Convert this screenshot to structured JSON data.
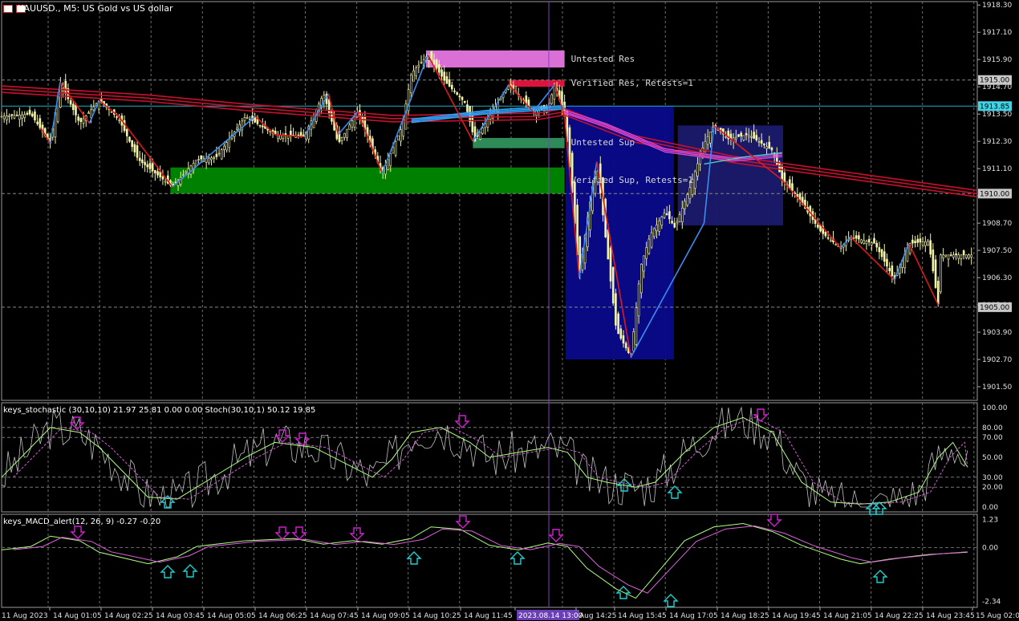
{
  "title": "XAUUSD., M5:  US Gold vs US dollar",
  "colors": {
    "bg": "#000000",
    "grid": "#6e6e6e",
    "bull": "#f5f5a8",
    "bear": "#f5f5a8",
    "ma_red": "#c8102e",
    "ma_magenta": "#d448d4",
    "ma_cyan": "#2ea8ff",
    "zz_blue": "#3b8cf0",
    "zz_red": "#e01919",
    "hline": "#1fb0c6",
    "stoch_main": "#c0c0c0",
    "stoch_sig": "#b0ff80",
    "stoch_dash": "#d060d0",
    "macd_main": "#b0ff80",
    "macd_sig": "#e060e0",
    "arrow_down": "#d020d0",
    "arrow_up": "#20d0d0"
  },
  "zones": [
    {
      "label": "Untested Res",
      "color": "#da70d6",
      "y_top": 1916.3,
      "y_bot": 1915.55,
      "x1": 0.435,
      "x2": 0.577
    },
    {
      "label": "Verified Res, Retests=1",
      "color": "#dc143c",
      "y_top": 1915.0,
      "y_bot": 1914.7,
      "x1": 0.52,
      "x2": 0.577
    },
    {
      "label": "Untested Sup",
      "color": "#2e8b57",
      "y_top": 1912.45,
      "y_bot": 1912.0,
      "x1": 0.483,
      "x2": 0.577
    },
    {
      "label": "Verified Sup, Retests=1",
      "color": "#008000",
      "y_top": 1911.15,
      "y_bot": 1910.0,
      "x1": 0.173,
      "x2": 0.577
    }
  ],
  "boxes": [
    {
      "color": "#0a0a8a",
      "y_top": 1913.85,
      "y_bot": 1902.7,
      "x1": 0.578,
      "x2": 0.689
    },
    {
      "color": "#1a1a6e",
      "y_top": 1913.0,
      "y_bot": 1908.6,
      "x1": 0.693,
      "x2": 0.801
    }
  ],
  "price_axis": {
    "ticks": [
      "1918.30",
      "1917.10",
      "1915.90",
      "1914.70",
      "1913.50",
      "1912.30",
      "1911.10",
      "1909.90",
      "1908.70",
      "1907.50",
      "1906.30",
      "1905.10",
      "1903.90",
      "1902.70",
      "1901.50"
    ],
    "highlight": [
      {
        "value": "1915.00",
        "style": "gray"
      },
      {
        "value": "1913.85",
        "style": "cyan"
      },
      {
        "value": "1910.00",
        "style": "gray"
      },
      {
        "value": "1905.00",
        "style": "gray"
      }
    ]
  },
  "time_axis": [
    "11 Aug 2023",
    "14 Aug 01:05",
    "14 Aug 02:25",
    "14 Aug 03:45",
    "14 Aug 05:05",
    "14 Aug 06:25",
    "14 Aug 07:45",
    "14 Aug 09:05",
    "14 Aug 10:25",
    "14 Aug 11:45",
    "2023.08.14 13:00",
    "Aug 14:25",
    "14 Aug 15:45",
    "14 Aug 17:05",
    "14 Aug 18:25",
    "14 Aug 19:45",
    "14 Aug 21:05",
    "14 Aug 22:25",
    "14 Aug 23:45",
    "15 Aug 02:05"
  ],
  "stoch_panel": {
    "label": "keys_stochastic (30,10,10) 21.97 25.81 0.00 0.00 Stoch(30,10,1) 50.12 19.85",
    "ticks": [
      "100.00",
      "80.00",
      "70.00",
      "50.00",
      "30.00",
      "20.00",
      "0.00"
    ]
  },
  "macd_panel": {
    "label": "keys_MACD_alert(12, 26, 9) -0.27 -0.20",
    "ticks": [
      "1.23",
      "0.00",
      "-2.34"
    ]
  },
  "chart_data": [
    {
      "type": "candlestick",
      "title": "XAUUSD., M5:  US Gold vs US dollar",
      "xlabel": "",
      "ylabel": "",
      "ylim": [
        1900.9,
        1918.45
      ],
      "price_path": [
        [
          0,
          1913.4
        ],
        [
          0.03,
          1913.5
        ],
        [
          0.05,
          1912.2
        ],
        [
          0.06,
          1914.9
        ],
        [
          0.08,
          1913.1
        ],
        [
          0.1,
          1914.1
        ],
        [
          0.12,
          1913.3
        ],
        [
          0.14,
          1911.5
        ],
        [
          0.175,
          1910.3
        ],
        [
          0.2,
          1911.5
        ],
        [
          0.22,
          1911.6
        ],
        [
          0.25,
          1913.4
        ],
        [
          0.28,
          1912.6
        ],
        [
          0.31,
          1912.5
        ],
        [
          0.33,
          1914.4
        ],
        [
          0.345,
          1912.2
        ],
        [
          0.365,
          1913.6
        ],
        [
          0.39,
          1910.9
        ],
        [
          0.41,
          1912.9
        ],
        [
          0.42,
          1915.3
        ],
        [
          0.437,
          1916.1
        ],
        [
          0.455,
          1914.9
        ],
        [
          0.475,
          1914.0
        ],
        [
          0.485,
          1912.3
        ],
        [
          0.5,
          1913.4
        ],
        [
          0.52,
          1914.8
        ],
        [
          0.545,
          1913.6
        ],
        [
          0.56,
          1913.8
        ],
        [
          0.567,
          1914.8
        ],
        [
          0.577,
          1913.4
        ],
        [
          0.585,
          1910.0
        ],
        [
          0.592,
          1906.3
        ],
        [
          0.6,
          1908.8
        ],
        [
          0.61,
          1911.4
        ],
        [
          0.63,
          1904.0
        ],
        [
          0.645,
          1902.8
        ],
        [
          0.655,
          1906.8
        ],
        [
          0.665,
          1908.2
        ],
        [
          0.68,
          1909.2
        ],
        [
          0.69,
          1908.5
        ],
        [
          0.705,
          1910.2
        ],
        [
          0.72,
          1912.2
        ],
        [
          0.73,
          1913.0
        ],
        [
          0.745,
          1912.4
        ],
        [
          0.765,
          1912.6
        ],
        [
          0.79,
          1911.9
        ],
        [
          0.8,
          1910.6
        ],
        [
          0.815,
          1909.9
        ],
        [
          0.84,
          1908.3
        ],
        [
          0.86,
          1907.6
        ],
        [
          0.87,
          1908.1
        ],
        [
          0.895,
          1907.8
        ],
        [
          0.915,
          1906.2
        ],
        [
          0.93,
          1907.8
        ],
        [
          0.95,
          1907.9
        ],
        [
          0.96,
          1905.1
        ],
        [
          0.96,
          1907.3
        ]
      ],
      "series": [
        {
          "name": "",
          "kind": "ma",
          "color": "ma_red",
          "values": [
            [
              0,
              1914.6
            ],
            [
              0.15,
              1914.2
            ],
            [
              0.25,
              1913.8
            ],
            [
              0.4,
              1913.3
            ],
            [
              0.55,
              1913.4
            ],
            [
              0.577,
              1913.6
            ],
            [
              0.65,
              1912.4
            ],
            [
              0.75,
              1911.5
            ],
            [
              0.85,
              1910.9
            ],
            [
              1,
              1910.0
            ]
          ]
        }
      ]
    },
    {
      "type": "line",
      "title": "keys_stochastic (30,10,10) 21.97 25.81 0.00 0.00 Stoch(30,10,1) 50.12 19.85",
      "ylim": [
        0,
        100
      ],
      "series": [
        {
          "name": "Stoch(30,10,1)",
          "values": [
            [
              0,
              30
            ],
            [
              0.03,
              60
            ],
            [
              0.05,
              80
            ],
            [
              0.08,
              75
            ],
            [
              0.1,
              60
            ],
            [
              0.12,
              40
            ],
            [
              0.15,
              10
            ],
            [
              0.18,
              8
            ],
            [
              0.2,
              20
            ],
            [
              0.25,
              50
            ],
            [
              0.28,
              65
            ],
            [
              0.32,
              60
            ],
            [
              0.35,
              45
            ],
            [
              0.38,
              30
            ],
            [
              0.4,
              48
            ],
            [
              0.42,
              75
            ],
            [
              0.45,
              80
            ],
            [
              0.48,
              65
            ],
            [
              0.5,
              50
            ],
            [
              0.53,
              55
            ],
            [
              0.56,
              60
            ],
            [
              0.58,
              55
            ],
            [
              0.6,
              30
            ],
            [
              0.62,
              25
            ],
            [
              0.65,
              20
            ],
            [
              0.67,
              25
            ],
            [
              0.7,
              55
            ],
            [
              0.73,
              80
            ],
            [
              0.76,
              90
            ],
            [
              0.79,
              75
            ],
            [
              0.82,
              25
            ],
            [
              0.85,
              5
            ],
            [
              0.88,
              3
            ],
            [
              0.91,
              5
            ],
            [
              0.94,
              15
            ],
            [
              0.96,
              50
            ],
            [
              0.975,
              65
            ],
            [
              0.99,
              40
            ]
          ]
        }
      ]
    },
    {
      "type": "line",
      "title": "keys_MACD_alert(12, 26, 9) -0.27 -0.20",
      "ylim": [
        -2.6,
        1.45
      ],
      "series": [
        {
          "name": "",
          "values": [
            [
              0,
              -0.1
            ],
            [
              0.03,
              0.05
            ],
            [
              0.05,
              0.5
            ],
            [
              0.08,
              0.3
            ],
            [
              0.1,
              -0.2
            ],
            [
              0.13,
              -0.5
            ],
            [
              0.15,
              -0.7
            ],
            [
              0.18,
              -0.4
            ],
            [
              0.2,
              0.05
            ],
            [
              0.25,
              0.3
            ],
            [
              0.3,
              0.4
            ],
            [
              0.33,
              0.15
            ],
            [
              0.36,
              0.3
            ],
            [
              0.39,
              0.15
            ],
            [
              0.42,
              0.4
            ],
            [
              0.44,
              0.9
            ],
            [
              0.47,
              0.8
            ],
            [
              0.5,
              0.1
            ],
            [
              0.53,
              -0.1
            ],
            [
              0.56,
              0.2
            ],
            [
              0.58,
              0.05
            ],
            [
              0.6,
              -0.9
            ],
            [
              0.63,
              -1.8
            ],
            [
              0.65,
              -2.2
            ],
            [
              0.67,
              -1.2
            ],
            [
              0.7,
              0.3
            ],
            [
              0.73,
              0.9
            ],
            [
              0.76,
              1.05
            ],
            [
              0.79,
              0.7
            ],
            [
              0.82,
              0.1
            ],
            [
              0.86,
              -0.5
            ],
            [
              0.88,
              -0.7
            ],
            [
              0.91,
              -0.5
            ],
            [
              0.95,
              -0.3
            ],
            [
              0.99,
              -0.2
            ]
          ]
        }
      ]
    }
  ]
}
